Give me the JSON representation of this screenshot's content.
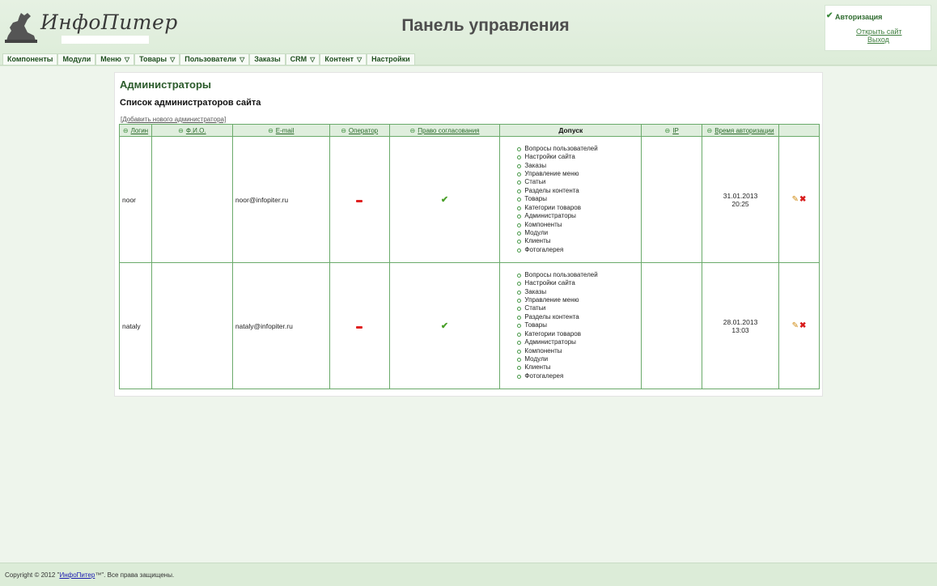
{
  "header": {
    "logo_text": "ИнфоПитер",
    "title": "Панель управления",
    "auth": {
      "title": "Авторизация",
      "open_site": "Открыть сайт",
      "logout": "Выход"
    }
  },
  "menu": [
    {
      "label": "Компоненты",
      "dropdown": false
    },
    {
      "label": "Модули",
      "dropdown": false
    },
    {
      "label": "Меню",
      "dropdown": true
    },
    {
      "label": "Товары",
      "dropdown": true
    },
    {
      "label": "Пользователи",
      "dropdown": true
    },
    {
      "label": "Заказы",
      "dropdown": false
    },
    {
      "label": "CRM",
      "dropdown": true
    },
    {
      "label": "Контент",
      "dropdown": true
    },
    {
      "label": "Настройки",
      "dropdown": false
    }
  ],
  "content": {
    "heading": "Администраторы",
    "subheading": "Список администраторов сайта",
    "add_link": "[Добавить нового администратора]",
    "columns": {
      "login": "Логин",
      "fio": "Ф.И.О.",
      "email": "E-mail",
      "operator": "Оператор",
      "approval": "Право согласования",
      "access": "Допуск",
      "ip": "IP",
      "auth_time": "Время авторизации"
    },
    "rows": [
      {
        "login": "noor",
        "fio": "",
        "email": "noor@infopiter.ru",
        "operator": false,
        "approval": true,
        "permissions": [
          "Вопросы пользователей",
          "Настройки сайта",
          "Заказы",
          "Управление меню",
          "Статьи",
          "Разделы контента",
          "Товары",
          "Категории товаров",
          "Администраторы",
          "Компоненты",
          "Модули",
          "Клиенты",
          "Фотогалерея"
        ],
        "ip": "",
        "auth_date": "31.01.2013",
        "auth_time": "20:25"
      },
      {
        "login": "nataly",
        "fio": "",
        "email": "nataly@infopiter.ru",
        "operator": false,
        "approval": true,
        "permissions": [
          "Вопросы пользователей",
          "Настройки сайта",
          "Заказы",
          "Управление меню",
          "Статьи",
          "Разделы контента",
          "Товары",
          "Категории товаров",
          "Администраторы",
          "Компоненты",
          "Модули",
          "Клиенты",
          "Фотогалерея"
        ],
        "ip": "",
        "auth_date": "28.01.2013",
        "auth_time": "13:03"
      }
    ]
  },
  "footer": {
    "prefix": "Copyright © 2012 \"",
    "link": "ИнфоПитер",
    "suffix": "™\". Все права защищены."
  },
  "colors": {
    "accent": "#2a5a2a",
    "table_border": "#6aaa6a",
    "header_bg": "#dfeedd"
  }
}
